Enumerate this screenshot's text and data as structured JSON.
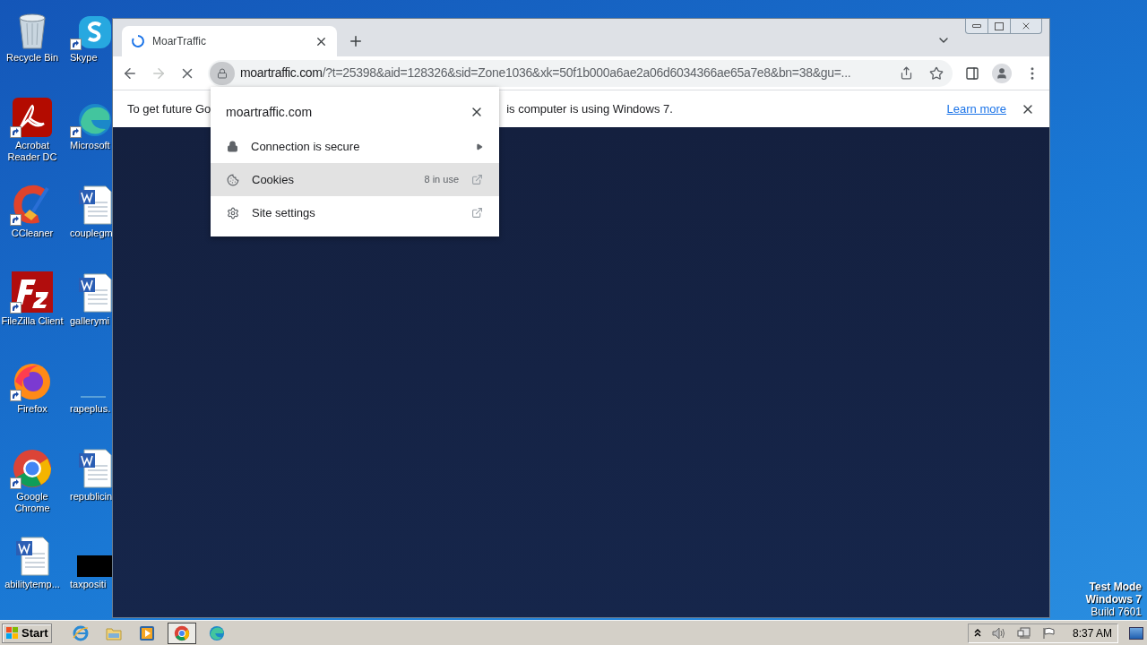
{
  "desktop_icons": [
    {
      "label": "Recycle Bin",
      "kind": "bin",
      "shortcut": false
    },
    {
      "label": "Skype",
      "kind": "skype",
      "shortcut": true
    },
    {
      "label": "Acrobat Reader DC",
      "kind": "acrobat",
      "shortcut": true
    },
    {
      "label": "Microsoft",
      "kind": "edge",
      "shortcut": true
    },
    {
      "label": "CCleaner",
      "kind": "ccleaner",
      "shortcut": true
    },
    {
      "label": "couplegm",
      "kind": "word",
      "shortcut": false
    },
    {
      "label": "FileZilla Client",
      "kind": "filezilla",
      "shortcut": true
    },
    {
      "label": "gallerymi",
      "kind": "word",
      "shortcut": false
    },
    {
      "label": "Firefox",
      "kind": "firefox",
      "shortcut": true
    },
    {
      "label": "rapeplus.",
      "kind": "blank",
      "shortcut": false
    },
    {
      "label": "Google Chrome",
      "kind": "chrome",
      "shortcut": true
    },
    {
      "label": "republicin",
      "kind": "word",
      "shortcut": false
    },
    {
      "label": "abilitytemp...",
      "kind": "word",
      "shortcut": false
    },
    {
      "label": "taxpositi",
      "kind": "black",
      "shortcut": false
    }
  ],
  "browser": {
    "tabs": [
      {
        "title": "MoarTraffic",
        "selected": true,
        "loading": true
      }
    ],
    "url_host": "moartraffic.com",
    "url_rest": "/?t=25398&aid=128326&sid=Zone1036&xk=50f1b000a6ae2a06d6034366ae65a7e8&bn=38&gu=...",
    "infobar": {
      "text_left": "To get future Go",
      "text_right": "is computer is using Windows 7.",
      "link": "Learn more"
    },
    "site_popup": {
      "title": "moartraffic.com",
      "items": [
        {
          "label": "Connection is secure",
          "kind": "submenu",
          "selected": false
        },
        {
          "label": "Cookies",
          "kind": "external",
          "note": "8 in use",
          "selected": true
        },
        {
          "label": "Site settings",
          "kind": "external",
          "selected": false
        }
      ]
    }
  },
  "watermark_os": [
    "Test Mode",
    "Windows 7",
    "Build 7601"
  ],
  "taskbar": {
    "start": "Start",
    "apps": [
      {
        "kind": "ie",
        "selected": false
      },
      {
        "kind": "explorer",
        "selected": false
      },
      {
        "kind": "media",
        "selected": false
      },
      {
        "kind": "chrome",
        "selected": true
      },
      {
        "kind": "edge",
        "selected": false
      }
    ],
    "clock": "8:37 AM"
  }
}
